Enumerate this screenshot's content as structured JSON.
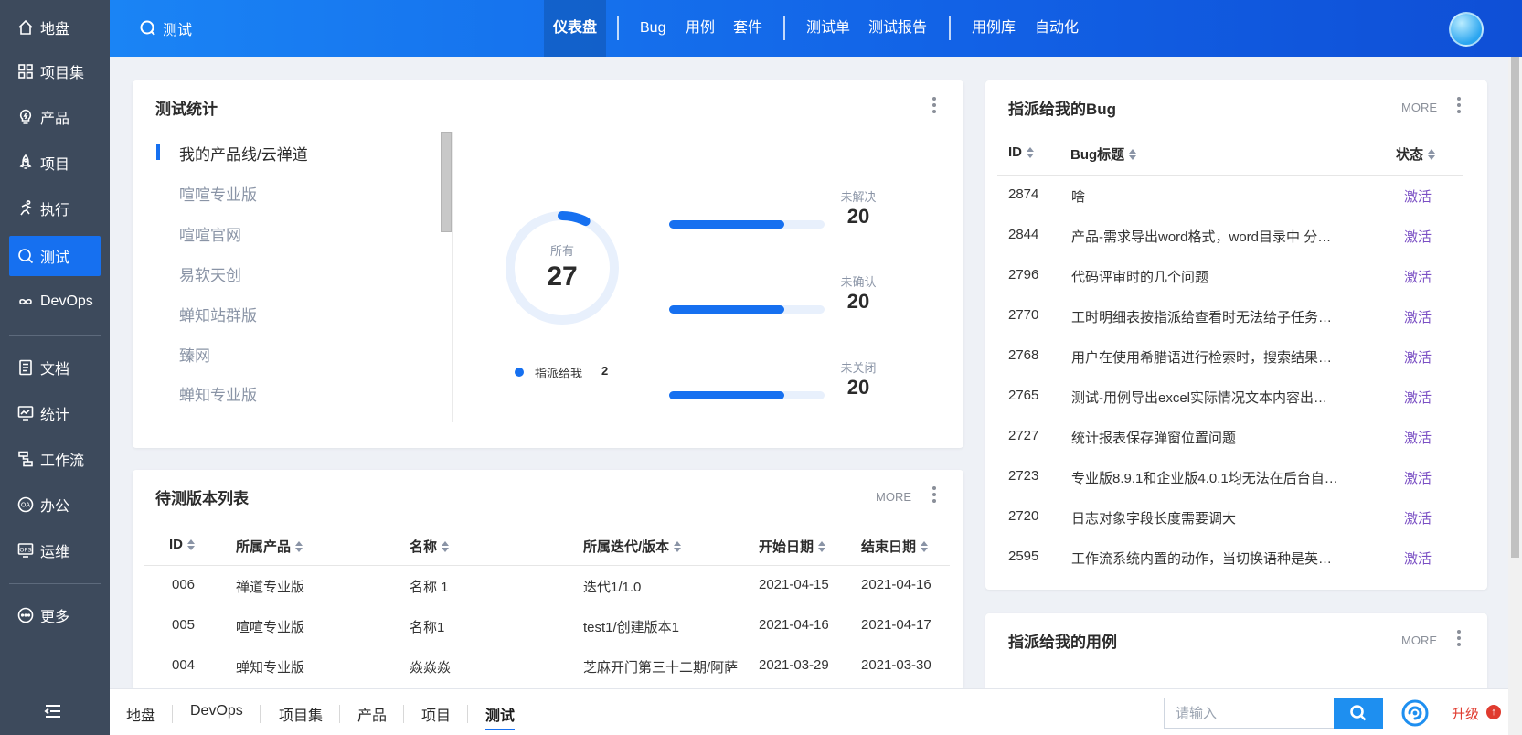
{
  "sidebar": {
    "items": [
      {
        "label": "地盘",
        "icon": "home-icon"
      },
      {
        "label": "项目集",
        "icon": "grid-icon"
      },
      {
        "label": "产品",
        "icon": "bulb-icon"
      },
      {
        "label": "项目",
        "icon": "rocket-icon"
      },
      {
        "label": "执行",
        "icon": "run-icon"
      },
      {
        "label": "测试",
        "icon": "search-icon",
        "active": true
      },
      {
        "label": "DevOps",
        "icon": "infinity-icon"
      },
      {
        "label": "文档",
        "icon": "document-icon"
      },
      {
        "label": "统计",
        "icon": "monitor-icon"
      },
      {
        "label": "工作流",
        "icon": "workflow-icon"
      },
      {
        "label": "办公",
        "icon": "oa-icon"
      },
      {
        "label": "运维",
        "icon": "ops-icon"
      },
      {
        "label": "更多",
        "icon": "more-icon"
      }
    ]
  },
  "header": {
    "app_title": "测试",
    "nav": [
      "仪表盘",
      "Bug",
      "用例",
      "套件",
      "测试单",
      "测试报告",
      "用例库",
      "自动化"
    ],
    "active_nav": "仪表盘"
  },
  "stats_panel": {
    "title": "测试统计",
    "products": [
      "我的产品线/云禅道",
      "喧喧专业版",
      "喧喧官网",
      "易软天创",
      "蝉知站群版",
      "臻网",
      "蝉知专业版"
    ],
    "active_product": "我的产品线/云禅道",
    "donut": {
      "label": "所有",
      "total": 27,
      "highlight": 2
    },
    "legend": {
      "label": "指派给我",
      "value": "2"
    },
    "bars": [
      {
        "label": "未解决",
        "value": "20",
        "fraction": 0.74
      },
      {
        "label": "未确认",
        "value": "20",
        "fraction": 0.74
      },
      {
        "label": "未关闭",
        "value": "20",
        "fraction": 0.74
      }
    ]
  },
  "bug_panel": {
    "title": "指派给我的Bug",
    "more": "MORE",
    "columns": [
      "ID",
      "Bug标题",
      "状态"
    ],
    "rows": [
      {
        "id": "2874",
        "title": "啥",
        "status": "激活"
      },
      {
        "id": "2844",
        "title": "产品-需求导出word格式，word目录中 分…",
        "status": "激活"
      },
      {
        "id": "2796",
        "title": "代码评审时的几个问题",
        "status": "激活"
      },
      {
        "id": "2770",
        "title": "工时明细表按指派给查看时无法给子任务…",
        "status": "激活"
      },
      {
        "id": "2768",
        "title": "用户在使用希腊语进行检索时，搜索结果…",
        "status": "激活"
      },
      {
        "id": "2765",
        "title": "测试-用例导出excel实际情况文本内容出…",
        "status": "激活"
      },
      {
        "id": "2727",
        "title": "统计报表保存弹窗位置问题",
        "status": "激活"
      },
      {
        "id": "2723",
        "title": "专业版8.9.1和企业版4.0.1均无法在后台自…",
        "status": "激活"
      },
      {
        "id": "2720",
        "title": "日志对象字段长度需要调大",
        "status": "激活"
      },
      {
        "id": "2595",
        "title": "工作流系统内置的动作，当切换语种是英…",
        "status": "激活"
      }
    ]
  },
  "build_panel": {
    "title": "待测版本列表",
    "more": "MORE",
    "columns": [
      "ID",
      "所属产品",
      "名称",
      "所属迭代/版本",
      "开始日期",
      "结束日期"
    ],
    "rows": [
      {
        "id": "006",
        "product": "禅道专业版",
        "name": "名称 1",
        "iteration": "迭代1/1.0",
        "start": "2021-04-15",
        "end": "2021-04-16"
      },
      {
        "id": "005",
        "product": "喧喧专业版",
        "name": "名称1",
        "iteration": "test1/创建版本1",
        "start": "2021-04-16",
        "end": "2021-04-17"
      },
      {
        "id": "004",
        "product": "蝉知专业版",
        "name": "焱焱焱",
        "iteration": "芝麻开门第三十二期/阿萨",
        "start": "2021-03-29",
        "end": "2021-03-30"
      }
    ]
  },
  "case_panel": {
    "title": "指派给我的用例",
    "more": "MORE"
  },
  "bottom_bar": {
    "tabs": [
      "地盘",
      "DevOps",
      "项目集",
      "产品",
      "项目",
      "测试"
    ],
    "active_tab": "测试",
    "search_placeholder": "请输入",
    "upgrade_label": "升级",
    "upgrade_icon": "↑"
  },
  "colors": {
    "sidebar_bg": "#3d4a5c",
    "accent": "#1670f0",
    "status_active": "#7a4fc4",
    "upgrade": "#e03b2f"
  }
}
